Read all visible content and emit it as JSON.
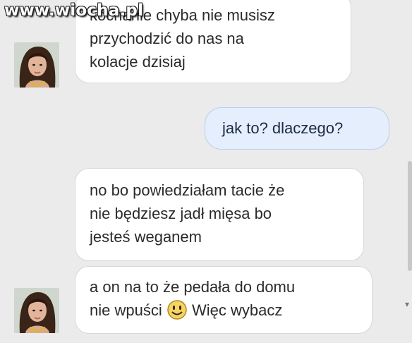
{
  "watermark": "www.wiocha.pl",
  "messages": [
    {
      "id": "m1",
      "side": "incoming",
      "lines": [
        "kochanie chyba nie musisz",
        "przychodzić do nas na",
        "kolacje dzisiaj"
      ]
    },
    {
      "id": "m2",
      "side": "outgoing",
      "lines": [
        "jak to? dlaczego?"
      ]
    },
    {
      "id": "m3",
      "side": "incoming",
      "lines": [
        "no bo powiedziałam tacie że",
        "nie będziesz jadł mięsa bo",
        "jesteś weganem"
      ]
    },
    {
      "id": "m4",
      "side": "incoming",
      "lines": [
        "a on na to że pedała do domu",
        "nie wpuści",
        "Więc wybacz"
      ],
      "emoji": "smiley-face-emoji"
    }
  ],
  "colors": {
    "background": "#ebebeb",
    "incoming_bubble": "#ffffff",
    "outgoing_bubble": "#e4eefc",
    "outgoing_border": "#b9cfef"
  },
  "avatar": {
    "icon": "user-avatar-photo"
  }
}
